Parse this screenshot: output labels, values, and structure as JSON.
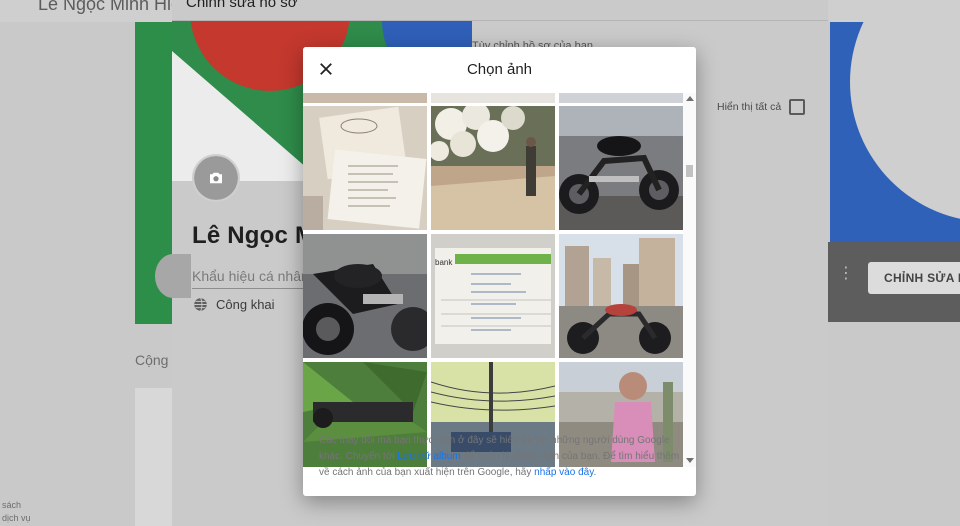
{
  "background": {
    "topbar_name": "Lê Ngọc Minh Hiế",
    "side_note_1": "sách",
    "side_note_2": "dịch vụ",
    "community_label": "Cộng",
    "edit_button": "CHỈNH SỬA H",
    "dots": "⋮"
  },
  "edit_panel": {
    "title": "Chỉnh sửa hồ sơ",
    "profile_name": "Lê Ngọc M",
    "slogan_placeholder": "Khẩu hiệu cá nhân",
    "visibility": "Công khai",
    "show_all_label": "Hiển thị tất cả",
    "heading_partial": "Tùy chỉnh hồ sơ của bạn"
  },
  "dialog": {
    "title": "Chọn ảnh",
    "footer": {
      "text_1": "Các thay đổi mà bạn thực hiện ở đây sẽ hiển thị với những người dùng Google khác. Chuyển tới ",
      "link_1": "Lưu trữ album",
      "text_2": " để quản lý album ảnh của bạn. Để tìm hiểu thêm về cách ảnh của bạn xuất hiện trên Google, hãy ",
      "link_2": "nhấp vào đây",
      "text_3": "."
    },
    "photos": [
      {
        "name": "photo-wedding-invitation",
        "bg": "#d9d2c7"
      },
      {
        "name": "photo-white-flowers-street",
        "bg": "#b8a48e"
      },
      {
        "name": "photo-black-motorcycle",
        "bg": "#5f6066"
      },
      {
        "name": "photo-motorcycle-closeup",
        "bg": "#4a4b4f"
      },
      {
        "name": "photo-bank-card",
        "bg": "#e5e3dc"
      },
      {
        "name": "photo-motorcycle-buildings",
        "bg": "#b9b6ae"
      },
      {
        "name": "photo-motorcycle-banana-trees",
        "bg": "#4c7a3a"
      },
      {
        "name": "photo-power-lines-street",
        "bg": "#aeb98e"
      },
      {
        "name": "photo-child-playground",
        "bg": "#a8a49a"
      }
    ]
  },
  "colors": {
    "link": "#1a73e8",
    "cover_green": "#2f8c4a",
    "cover_red": "#c4382e",
    "cover_blue": "#2f5fb8"
  }
}
